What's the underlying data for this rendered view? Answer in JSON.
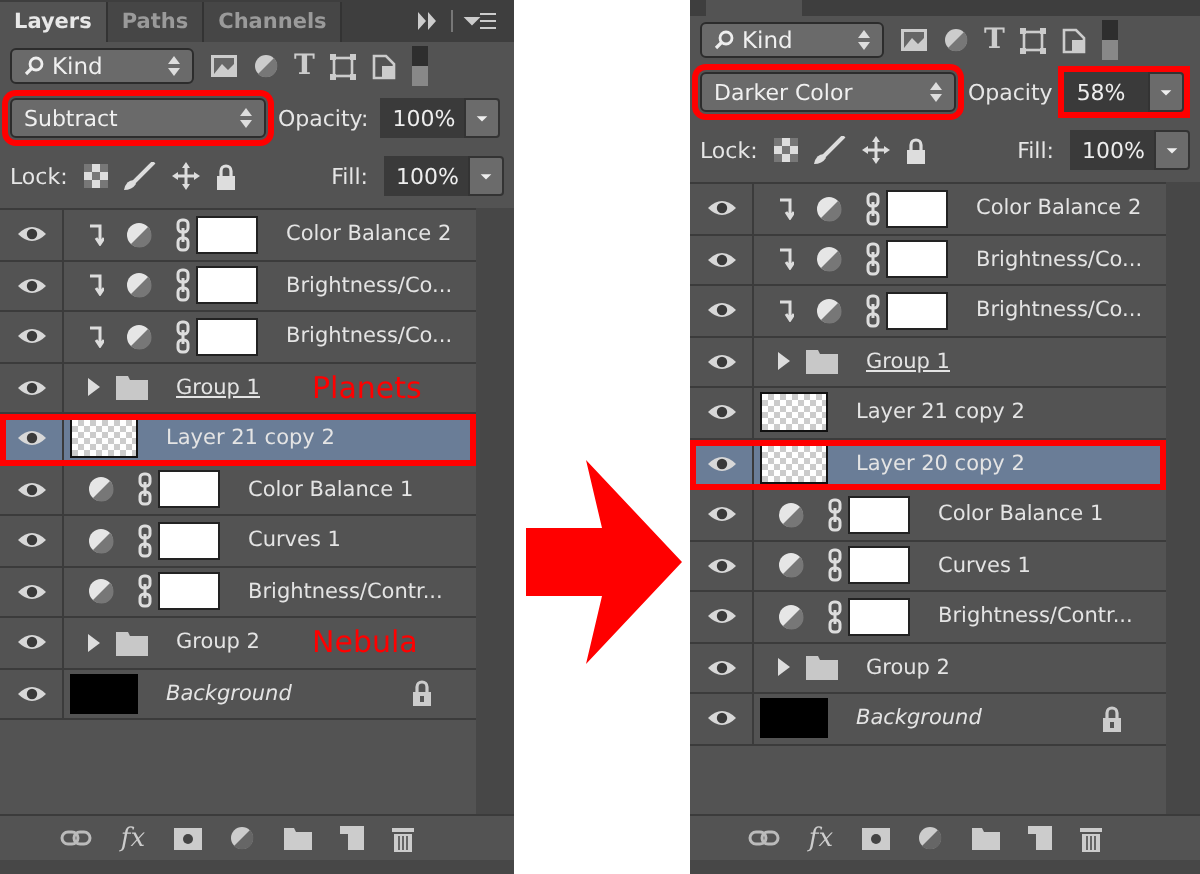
{
  "panels": [
    {
      "tabs": [
        {
          "label": "Layers",
          "selected": true
        },
        {
          "label": "Paths",
          "selected": false
        },
        {
          "label": "Channels",
          "selected": false
        }
      ],
      "filter": {
        "value": "Kind",
        "type_glyph": "T"
      },
      "blend_mode": {
        "value": "Subtract",
        "highlighted": true
      },
      "opacity": {
        "label": "Opacity:",
        "value": "100%",
        "highlighted": false
      },
      "lock_label": "Lock:",
      "fill": {
        "label": "Fill:",
        "value": "100%"
      },
      "layers": [
        {
          "kind": "adjustment",
          "name": "Color Balance 2",
          "clipped": true,
          "selected": false,
          "highlighted": false
        },
        {
          "kind": "adjustment",
          "name": "Brightness/Co...",
          "clipped": true,
          "selected": false,
          "highlighted": false
        },
        {
          "kind": "adjustment",
          "name": "Brightness/Co...",
          "clipped": true,
          "selected": false,
          "highlighted": false
        },
        {
          "kind": "group",
          "name": "Group 1",
          "underlined": true,
          "note": "Planets",
          "selected": false,
          "highlighted": false
        },
        {
          "kind": "pixel",
          "name": "Layer 21 copy 2",
          "selected": true,
          "highlighted": true
        },
        {
          "kind": "adjustment",
          "name": "Color Balance 1",
          "clipped": false,
          "selected": false,
          "highlighted": false
        },
        {
          "kind": "adjustment",
          "name": "Curves 1",
          "clipped": false,
          "selected": false,
          "highlighted": false
        },
        {
          "kind": "adjustment",
          "name": "Brightness/Contr...",
          "clipped": false,
          "selected": false,
          "highlighted": false
        },
        {
          "kind": "group",
          "name": "Group 2",
          "underlined": false,
          "note": "Nebula",
          "selected": false,
          "highlighted": false
        },
        {
          "kind": "background",
          "name": "Background",
          "selected": false,
          "highlighted": false
        }
      ],
      "fx_label": "fx"
    },
    {
      "filter": {
        "value": "Kind",
        "type_glyph": "T"
      },
      "blend_mode": {
        "value": "Darker Color",
        "highlighted": true
      },
      "opacity": {
        "label": "Opacity",
        "value": "58%",
        "highlighted": true
      },
      "lock_label": "Lock:",
      "fill": {
        "label": "Fill:",
        "value": "100%"
      },
      "layers": [
        {
          "kind": "adjustment",
          "name": "Color Balance 2",
          "clipped": true,
          "selected": false,
          "highlighted": false
        },
        {
          "kind": "adjustment",
          "name": "Brightness/Co...",
          "clipped": true,
          "selected": false,
          "highlighted": false
        },
        {
          "kind": "adjustment",
          "name": "Brightness/Co...",
          "clipped": true,
          "selected": false,
          "highlighted": false
        },
        {
          "kind": "group",
          "name": "Group 1",
          "underlined": true,
          "selected": false,
          "highlighted": false
        },
        {
          "kind": "pixel",
          "name": "Layer 21 copy 2",
          "selected": false,
          "highlighted": false
        },
        {
          "kind": "pixel",
          "name": "Layer 20 copy 2",
          "selected": true,
          "highlighted": true
        },
        {
          "kind": "adjustment",
          "name": "Color Balance 1",
          "clipped": false,
          "selected": false,
          "highlighted": false
        },
        {
          "kind": "adjustment",
          "name": "Curves 1",
          "clipped": false,
          "selected": false,
          "highlighted": false
        },
        {
          "kind": "adjustment",
          "name": "Brightness/Contr...",
          "clipped": false,
          "selected": false,
          "highlighted": false
        },
        {
          "kind": "group",
          "name": "Group 2",
          "underlined": false,
          "selected": false,
          "highlighted": false
        },
        {
          "kind": "background",
          "name": "Background",
          "selected": false,
          "highlighted": false
        }
      ],
      "fx_label": "fx"
    }
  ]
}
